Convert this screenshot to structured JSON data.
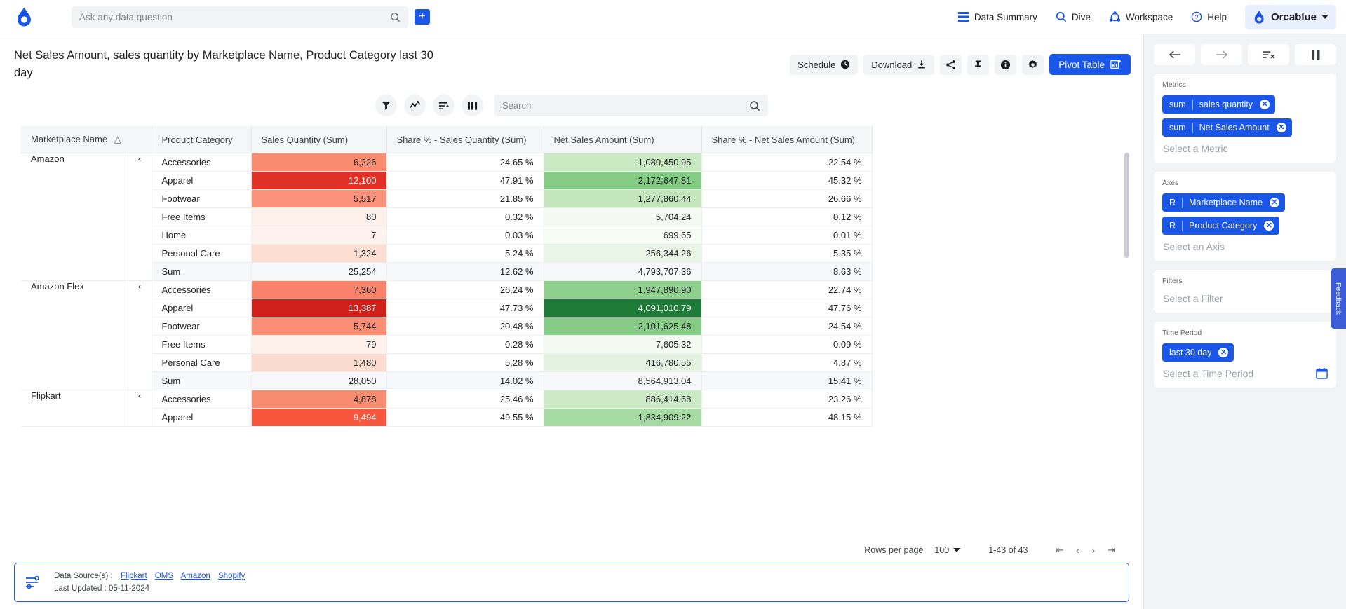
{
  "topnav": {
    "logo_icon": "orca-logo-icon",
    "search": {
      "placeholder": "Ask any data question",
      "value": "",
      "icon": "search-icon"
    },
    "add_button_label": "+",
    "items": [
      {
        "label": "Data Summary",
        "icon": "list-icon"
      },
      {
        "label": "Dive",
        "icon": "search-icon"
      },
      {
        "label": "Workspace",
        "icon": "workspace-icon"
      },
      {
        "label": "Help",
        "icon": "help-circle-icon"
      }
    ],
    "user": {
      "label": "Orcablue",
      "icon": "orca-logo-icon",
      "caret": "chevron-down-icon"
    }
  },
  "header": {
    "title": "Net Sales Amount, sales quantity by Marketplace Name, Product Category last 30 day",
    "toolbar": {
      "schedule_label": "Schedule",
      "schedule_icon": "clock-icon",
      "download_label": "Download",
      "download_icon": "download-icon",
      "share_icon": "share-icon",
      "pin_icon": "pin-icon",
      "info_icon": "info-icon",
      "settings_icon": "gear-icon",
      "pivot_label": "Pivot Table",
      "pivot_icon": "pivot-table-icon"
    }
  },
  "table_tools": {
    "filter_icon": "filter-icon",
    "trend_icon": "trend-line-icon",
    "sort_icon": "sort-icon",
    "columns_icon": "columns-icon",
    "search": {
      "placeholder": "Search",
      "value": "",
      "icon": "search-icon"
    }
  },
  "table": {
    "columns": [
      "Marketplace Name",
      "Product Category",
      "Sales Quantity (Sum)",
      "Share % - Sales Quantity (Sum)",
      "Net Sales Amount (Sum)",
      "Share % - Net Sales Amount (Sum)"
    ],
    "sort_icon": "sort-asc-icon",
    "collapse_icon": "chevron-left-icon",
    "groups": [
      {
        "marketplace": "Amazon",
        "rows": [
          {
            "category": "Accessories",
            "qty": "6,226",
            "qty_color": "#f98b6f",
            "qty_text": "#202124",
            "share_qty": "24.65 %",
            "net": "1,080,450.95",
            "net_color": "#c9e9c2",
            "net_text": "#202124",
            "share_net": "22.54 %"
          },
          {
            "category": "Apparel",
            "qty": "12,100",
            "qty_color": "#e03127",
            "qty_text": "#ffffff",
            "share_qty": "47.91 %",
            "net": "2,172,647.81",
            "net_color": "#84cb86",
            "net_text": "#202124",
            "share_net": "45.32 %"
          },
          {
            "category": "Footwear",
            "qty": "5,517",
            "qty_color": "#fa917a",
            "qty_text": "#202124",
            "share_qty": "21.85 %",
            "net": "1,277,860.44",
            "net_color": "#c3e6bc",
            "net_text": "#202124",
            "share_net": "26.66 %"
          },
          {
            "category": "Free Items",
            "qty": "80",
            "qty_color": "#fdf0eb",
            "qty_text": "#202124",
            "share_qty": "0.32 %",
            "net": "5,704.24",
            "net_color": "#f4faf2",
            "net_text": "#202124",
            "share_net": "0.12 %"
          },
          {
            "category": "Home",
            "qty": "7",
            "qty_color": "#fdf2ee",
            "qty_text": "#202124",
            "share_qty": "0.03 %",
            "net": "699.65",
            "net_color": "#f6fbf4",
            "net_text": "#202124",
            "share_net": "0.01 %"
          },
          {
            "category": "Personal Care",
            "qty": "1,324",
            "qty_color": "#fcded2",
            "qty_text": "#202124",
            "share_qty": "5.24 %",
            "net": "256,344.26",
            "net_color": "#e9f5e6",
            "net_text": "#202124",
            "share_net": "5.35 %"
          }
        ],
        "sum": {
          "label": "Sum",
          "qty": "25,254",
          "share_qty": "12.62 %",
          "net": "4,793,707.36",
          "share_net": "8.63 %"
        }
      },
      {
        "marketplace": "Amazon Flex",
        "rows": [
          {
            "category": "Accessories",
            "qty": "7,360",
            "qty_color": "#f9826a",
            "qty_text": "#202124",
            "share_qty": "26.24 %",
            "net": "1,947,890.90",
            "net_color": "#8fd08f",
            "net_text": "#202124",
            "share_net": "22.74 %"
          },
          {
            "category": "Apparel",
            "qty": "13,387",
            "qty_color": "#cf2119",
            "qty_text": "#ffffff",
            "share_qty": "47.73 %",
            "net": "4,091,010.79",
            "net_color": "#1e7a37",
            "net_text": "#ffffff",
            "share_net": "47.76 %"
          },
          {
            "category": "Footwear",
            "qty": "5,744",
            "qty_color": "#fa8e74",
            "qty_text": "#202124",
            "share_qty": "20.48 %",
            "net": "2,101,625.48",
            "net_color": "#86cc87",
            "net_text": "#202124",
            "share_net": "24.54 %"
          },
          {
            "category": "Free Items",
            "qty": "79",
            "qty_color": "#fdf1ec",
            "qty_text": "#202124",
            "share_qty": "0.28 %",
            "net": "7,605.32",
            "net_color": "#f4faf2",
            "net_text": "#202124",
            "share_net": "0.09 %"
          },
          {
            "category": "Personal Care",
            "qty": "1,480",
            "qty_color": "#fcdbcf",
            "qty_text": "#202124",
            "share_qty": "5.28 %",
            "net": "416,780.55",
            "net_color": "#e4f3e1",
            "net_text": "#202124",
            "share_net": "4.87 %"
          }
        ],
        "sum": {
          "label": "Sum",
          "qty": "28,050",
          "share_qty": "14.02 %",
          "net": "8,564,913.04",
          "share_net": "15.41 %"
        }
      },
      {
        "marketplace": "Flipkart",
        "rows": [
          {
            "category": "Accessories",
            "qty": "4,878",
            "qty_color": "#f88c70",
            "qty_text": "#202124",
            "share_qty": "25.46 %",
            "net": "886,414.68",
            "net_color": "#cdeac6",
            "net_text": "#202124",
            "share_net": "23.26 %"
          },
          {
            "category": "Apparel",
            "qty": "9,494",
            "qty_color": "#f7553c",
            "qty_text": "#ffffff",
            "share_qty": "49.55 %",
            "net": "1,834,909.22",
            "net_color": "#a7dba4",
            "net_text": "#202124",
            "share_net": "48.15 %"
          }
        ],
        "sum": null
      }
    ]
  },
  "pagination": {
    "rows_per_page_label": "Rows per page",
    "rows_per_page_value": "100",
    "range_label": "1-43 of 43",
    "first_icon": "first-page-icon",
    "prev_icon": "prev-page-icon",
    "next_icon": "next-page-icon",
    "last_icon": "last-page-icon"
  },
  "footer": {
    "icon": "data-source-icon",
    "sources_label": "Data Source(s) :",
    "sources": [
      "Flipkart",
      "OMS",
      "Amazon",
      "Shopify"
    ],
    "last_updated_label": "Last Updated :",
    "last_updated_value": "05-11-2024"
  },
  "rightpanel": {
    "toolbar": {
      "back_icon": "arrow-left-icon",
      "forward_icon": "arrow-right-icon",
      "clear_icon": "clear-filters-icon",
      "pause_icon": "pause-icon"
    },
    "metrics": {
      "label": "Metrics",
      "chips": [
        {
          "agg": "sum",
          "name": "sales quantity",
          "remove_icon": "remove-chip-icon"
        },
        {
          "agg": "sum",
          "name": "Net Sales Amount",
          "remove_icon": "remove-chip-icon"
        }
      ],
      "placeholder": "Select a Metric"
    },
    "axes": {
      "label": "Axes",
      "chips": [
        {
          "agg": "R",
          "name": "Marketplace Name",
          "remove_icon": "remove-chip-icon"
        },
        {
          "agg": "R",
          "name": "Product Category",
          "remove_icon": "remove-chip-icon"
        }
      ],
      "placeholder": "Select an Axis"
    },
    "filters": {
      "label": "Filters",
      "placeholder": "Select a Filter"
    },
    "time_period": {
      "label": "Time Period",
      "chips": [
        {
          "name": "last 30 day",
          "remove_icon": "remove-chip-icon"
        }
      ],
      "placeholder": "Select a Time Period",
      "calendar_icon": "calendar-icon"
    },
    "accent_color": "#1a56e8"
  },
  "feedback_tab": {
    "label": "Feedback"
  }
}
